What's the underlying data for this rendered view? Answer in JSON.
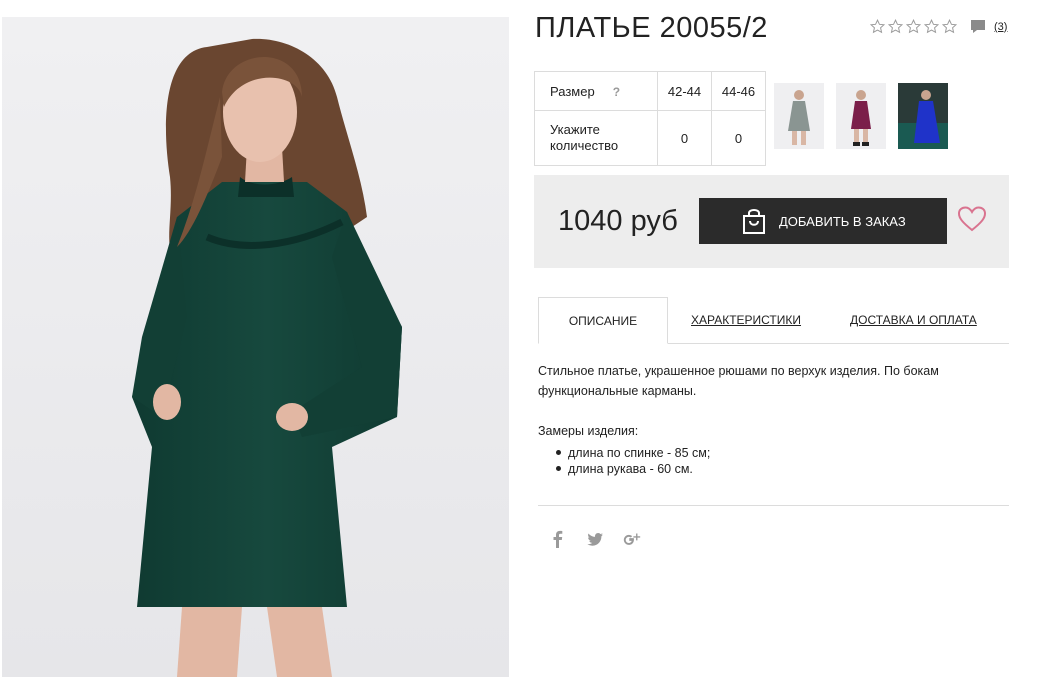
{
  "product": {
    "title": "ПЛАТЬЕ 20055/2",
    "review_count": "(3)",
    "rating_stars": 0
  },
  "sizes": {
    "size_label": "Размер",
    "help": "?",
    "options": [
      "42-44",
      "44-46"
    ],
    "qty_label_line1": "Укажите",
    "qty_label_line2": "количество",
    "quantities": [
      "0",
      "0"
    ]
  },
  "thumbnails": [
    {
      "color": "#8a9592"
    },
    {
      "color": "#7b1f4a"
    },
    {
      "color": "#1f33c9"
    }
  ],
  "buy": {
    "price": "1040 руб",
    "add_label": "ДОБАВИТЬ В ЗАКАЗ"
  },
  "tabs": {
    "description": "ОПИСАНИЕ",
    "characteristics": "ХАРАКТЕРИСТИКИ",
    "delivery": "ДОСТАВКА И ОПЛАТА"
  },
  "description": {
    "line1": "Стильное платье, украшенное рюшами по верхук изделия. По бокам",
    "line2": "функциональные карманы.",
    "measures_title": "Замеры изделия:",
    "measures": [
      "длина по спинке - 85 см;",
      "длина рукава - 60 см."
    ]
  },
  "colors": {
    "accent_heart": "#d9738f",
    "button_bg": "#2b2b2b",
    "dress_main": "#15453b"
  }
}
